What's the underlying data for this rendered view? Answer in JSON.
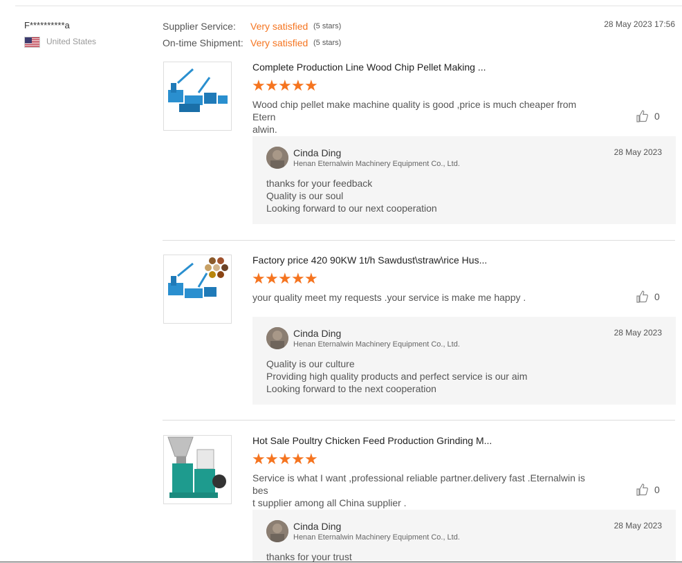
{
  "reviewer": {
    "name": "F**********a",
    "country": "United States",
    "flag_icon": "us-flag-icon"
  },
  "ratings": {
    "supplier_service_label": "Supplier Service:",
    "supplier_service_value": "Very satisfied",
    "supplier_service_stars": "(5 stars)",
    "shipment_label": "On-time Shipment:",
    "shipment_value": "Very satisfied",
    "shipment_stars": "(5 stars)"
  },
  "review_date": "28 May 2023 17:56",
  "colors": {
    "accent": "#f5741f",
    "reply_bg": "#f5f5f5"
  },
  "products": [
    {
      "title": "Complete Production Line Wood Chip Pellet Making ...",
      "stars": 5,
      "comment_lines": [
        "Wood chip pellet make machine quality is good ,price is much cheaper from Etern",
        "alwin."
      ],
      "likes": "0",
      "reply": {
        "name": "Cinda Ding",
        "company": "Henan Eternalwin Machinery Equipment Co., Ltd.",
        "date": "28 May 2023",
        "lines": [
          "thanks for your feedback",
          "Quality is our soul",
          "Looking forward to our next cooperation"
        ]
      }
    },
    {
      "title": "Factory price 420 90KW 1t/h Sawdust\\straw\\rice Hus...",
      "stars": 5,
      "comment_lines": [
        "your quality meet my requests .your service is make me happy ."
      ],
      "likes": "0",
      "reply": {
        "name": "Cinda Ding",
        "company": "Henan Eternalwin Machinery Equipment Co., Ltd.",
        "date": "28 May 2023",
        "lines": [
          "Quality is our culture",
          "Providing high quality products and perfect service is our aim",
          "Looking forward to the next cooperation"
        ]
      }
    },
    {
      "title": "Hot Sale Poultry Chicken Feed Production Grinding M...",
      "stars": 5,
      "comment_lines": [
        "Service is what I want ,professional reliable partner.delivery fast .Eternalwin is bes",
        "t supplier among all China supplier ."
      ],
      "likes": "0",
      "reply": {
        "name": "Cinda Ding",
        "company": "Henan Eternalwin Machinery Equipment Co., Ltd.",
        "date": "28 May 2023",
        "lines": [
          "thanks for your trust"
        ]
      }
    }
  ]
}
